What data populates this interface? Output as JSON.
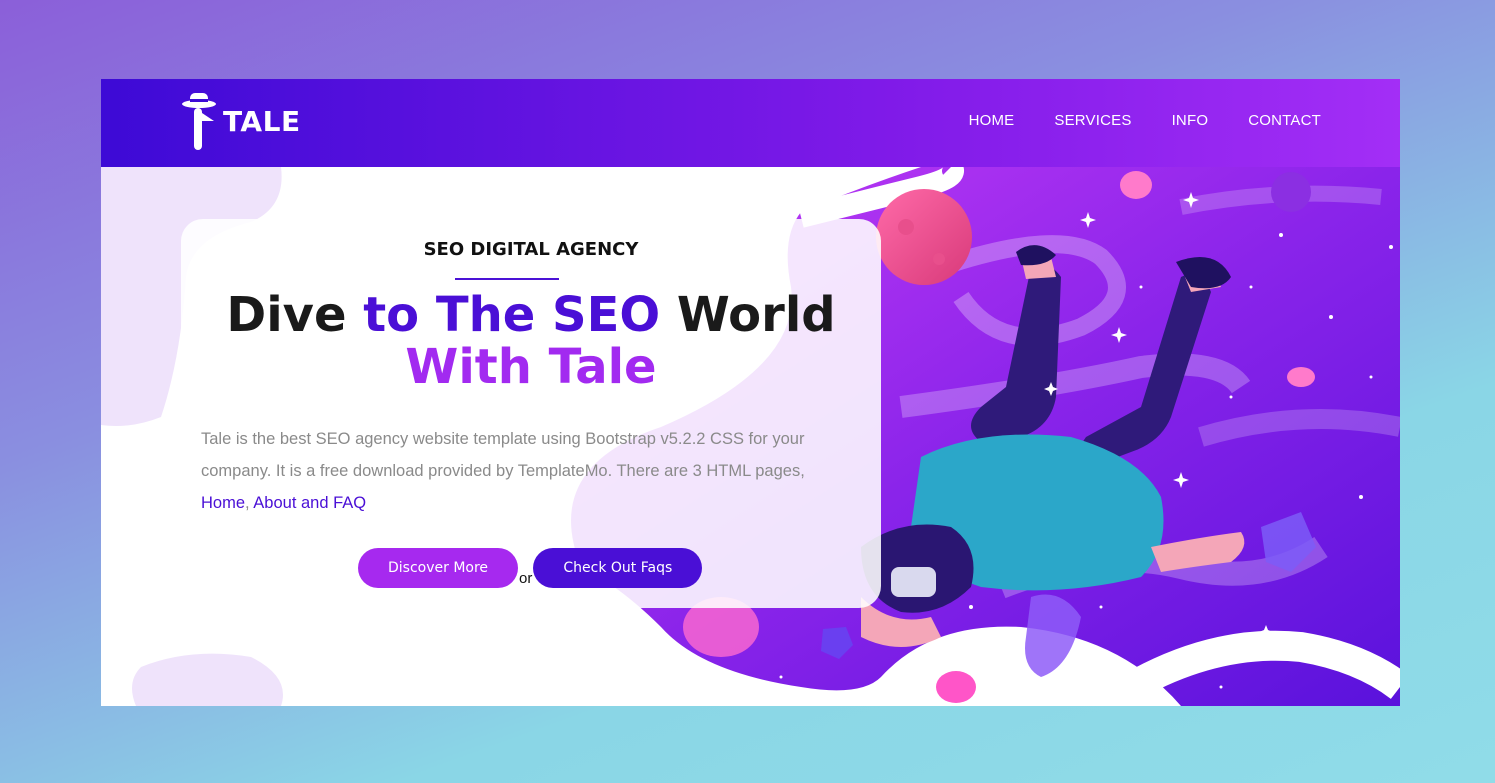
{
  "brand": {
    "name": "TALE",
    "logo_icon": "hat-t-logo-icon"
  },
  "nav": {
    "items": [
      {
        "label": "HOME"
      },
      {
        "label": "SERVICES"
      },
      {
        "label": "INFO"
      },
      {
        "label": "CONTACT"
      }
    ]
  },
  "hero": {
    "eyebrow": "SEO DIGITAL AGENCY",
    "headline": {
      "part1": "Dive ",
      "part2": "to The SEO",
      "part3": " World",
      "line2": "With Tale"
    },
    "description_text": "Tale is the best SEO agency website template using Bootstrap v5.2.2 CSS for your company. It is a free download provided by TemplateMo. There are 3 HTML pages, ",
    "description_links": {
      "home": "Home",
      "sep": ", ",
      "about_faq": "About and FAQ"
    },
    "buttons": {
      "discover": "Discover More",
      "or": "or",
      "faq": "Check Out Faqs"
    },
    "illustration": "astronaut-vr-space-illustration"
  },
  "colors": {
    "header_start": "#3d0ad6",
    "header_end": "#a32ef6",
    "accent_blue": "#4a0fd6",
    "accent_purple": "#a629ef"
  }
}
